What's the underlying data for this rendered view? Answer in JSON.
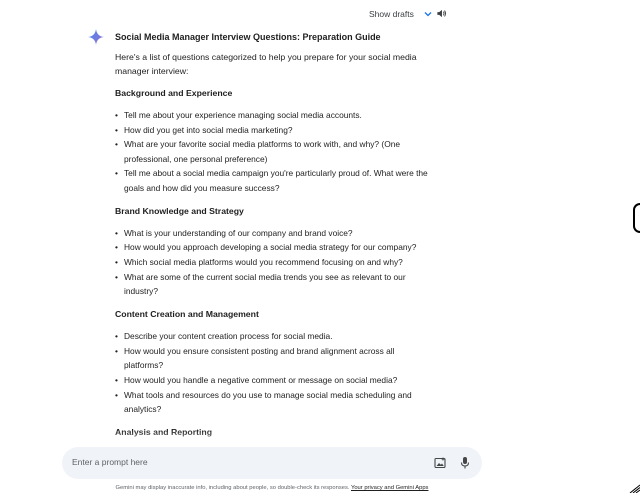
{
  "topbar": {
    "show_drafts": "Show drafts"
  },
  "response": {
    "title": "Social Media Manager Interview Questions: Preparation Guide",
    "intro": "Here's a list of questions categorized to help you prepare for your social media manager interview:",
    "sections": [
      {
        "heading": "Background and Experience",
        "items": [
          "Tell me about your experience managing social media accounts.",
          "How did you get into social media marketing?",
          "What are your favorite social media platforms to work with, and why? (One professional, one personal preference)",
          "Tell me about a social media campaign you're particularly proud of. What were the goals and how did you measure success?"
        ]
      },
      {
        "heading": "Brand Knowledge and Strategy",
        "items": [
          "What is your understanding of our company and brand voice?",
          "How would you approach developing a social media strategy for our company?",
          "Which social media platforms would you recommend focusing on and why?",
          "What are some of the current social media trends you see as relevant to our industry?"
        ]
      },
      {
        "heading": "Content Creation and Management",
        "items": [
          "Describe your content creation process for social media.",
          "How would you ensure consistent posting and brand alignment across all platforms?",
          "How would you handle a negative comment or message on social media?",
          "What tools and resources do you use to manage social media scheduling and analytics?"
        ]
      },
      {
        "heading": "Analysis and Reporting",
        "items": []
      }
    ]
  },
  "input": {
    "placeholder": "Enter a prompt here"
  },
  "footer": {
    "disclaimer": "Gemini may display inaccurate info, including about people, so double-check its responses.",
    "link": "Your privacy and Gemini Apps"
  },
  "icons": {
    "gemini": "gemini-spark-icon",
    "chevron": "chevron-down-icon",
    "speaker": "speaker-icon",
    "image": "add-image-icon",
    "mic": "microphone-icon"
  },
  "colors": {
    "gemini_blue": "#4285f4",
    "input_bg": "#f0f4f9",
    "text": "#1f1f1f"
  }
}
